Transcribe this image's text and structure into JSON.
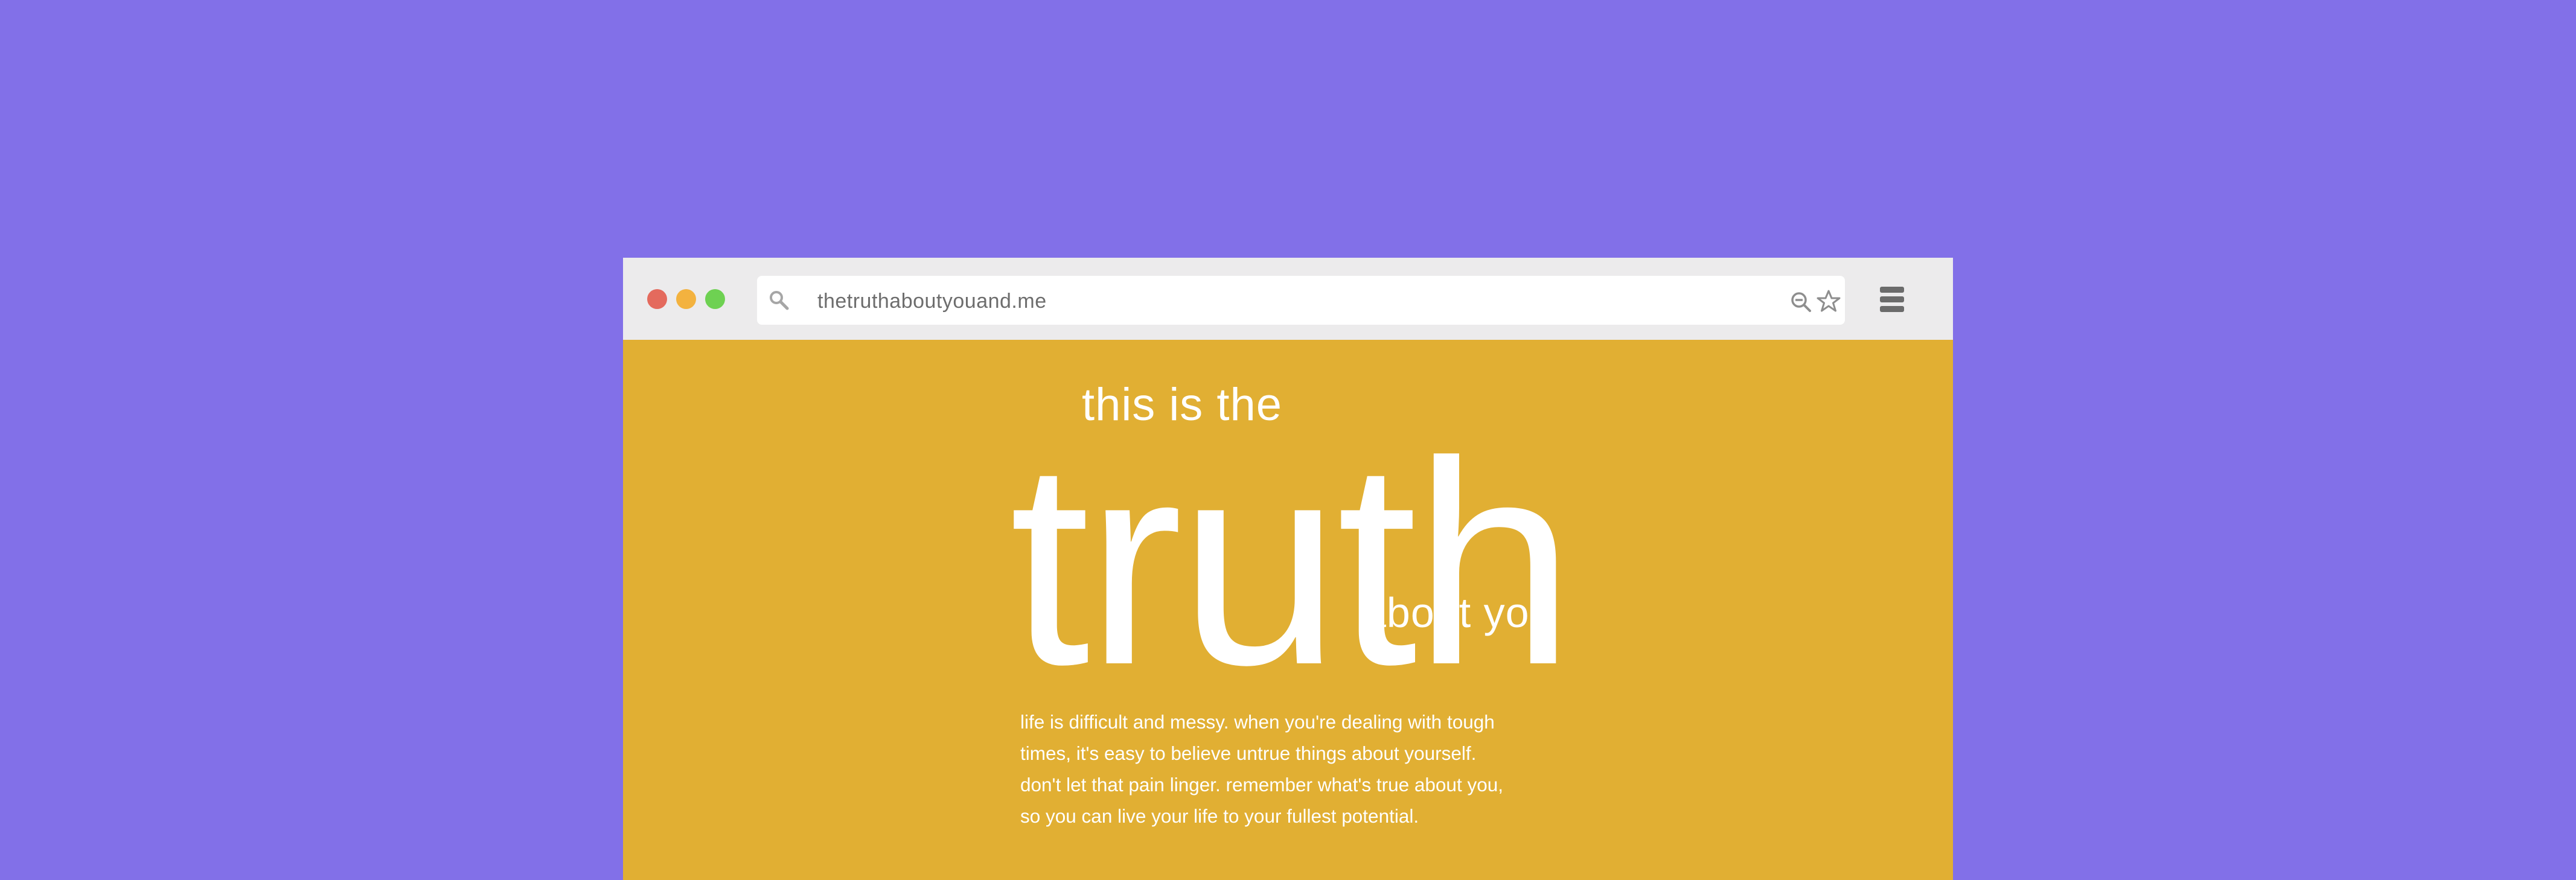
{
  "browser": {
    "window_controls": [
      "close",
      "minimize",
      "maximize"
    ],
    "address_bar": {
      "url": "thetruthaboutyouand.me"
    },
    "icons": {
      "search": "search-icon",
      "zoom": "zoom-out-icon",
      "bookmark": "star-icon",
      "menu": "hamburger-menu-icon"
    },
    "colors": {
      "close": "#e46a5d",
      "minimize": "#f3b23f",
      "maximize": "#6ed152"
    }
  },
  "page": {
    "background": "#e1af33",
    "outer_background": "#8270e8",
    "hero": {
      "top_text": "this is the",
      "main_text": "truth",
      "bottom_text": "about you"
    },
    "body_lines": [
      "life is difficult and messy. when you're dealing with tough",
      "times, it's easy to believe untrue things about yourself.",
      "don't let that pain linger. remember what's true about you,",
      "so you can live your life to your fullest potential."
    ]
  }
}
